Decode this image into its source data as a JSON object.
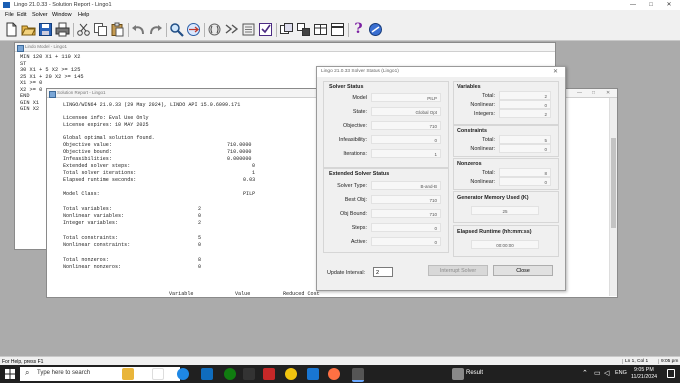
{
  "app": {
    "title": "Lingo 21.0.33 - Solution Report - Lingo1",
    "min": "—",
    "max": "□",
    "close": "✕"
  },
  "menu": [
    "File",
    "Edit",
    "Solver",
    "Window",
    "Help"
  ],
  "toolbar_icons": [
    "new-file-icon",
    "open-file-icon",
    "save-icon",
    "print-icon",
    "cut-icon",
    "copy-icon",
    "paste-icon",
    "undo-icon",
    "redo-icon",
    "find-icon",
    "goto-icon",
    "match-parenthesis-icon",
    "solve-icon",
    "solution-icon",
    "formulation-icon",
    "options-icon",
    "send-to-back-icon",
    "close-all-icon",
    "tile-icon",
    "help-icon",
    "context-help-icon"
  ],
  "model_window": {
    "title": "Lindo Model - Lingo1",
    "text": "MIN 120 X1 + 110 X2\nST\n30 X1 + 5 X2 >= 125\n25 X1 + 20 X2 >= 145\nX1 >= 0\nX2 >= 0\nEND\nGIN X1\nGIN X2"
  },
  "report_window": {
    "title": "Solution Report - Lingo1",
    "header": "LINGO/WIN64 21.0.33 (29 May 2024), LINDO API 15.0.6099.171",
    "license1": "Licensee info: Eval Use Only",
    "license2": "License expires: 10 MAY 2025",
    "found": "Global optimal solution found.",
    "rows": [
      [
        "Objective value:",
        "710.0000"
      ],
      [
        "Objective bound:",
        "710.0000"
      ],
      [
        "Infeasibilities:",
        "0.000000"
      ],
      [
        "Extended solver steps:",
        "0"
      ],
      [
        "Total solver iterations:",
        "1"
      ],
      [
        "Elapsed runtime seconds:",
        "0.03"
      ]
    ],
    "model_class": [
      "Model Class:",
      "PILP"
    ],
    "counts1": [
      [
        "Total variables:",
        "2"
      ],
      [
        "Nonlinear variables:",
        "0"
      ],
      [
        "Integer variables:",
        "2"
      ]
    ],
    "counts2": [
      [
        "Total constraints:",
        "5"
      ],
      [
        "Nonlinear constraints:",
        "0"
      ]
    ],
    "counts3": [
      [
        "Total nonzeros:",
        "8"
      ],
      [
        "Nonlinear nonzeros:",
        "0"
      ]
    ],
    "table_header": [
      "Variable",
      "Value",
      "Reduced Cost"
    ]
  },
  "dialog": {
    "title": "Lingo 21.0.33 Solver Status (Lingo1)",
    "solver_status": {
      "title": "Solver Status",
      "rows": [
        [
          "Model",
          "PILP"
        ],
        [
          "State:",
          "Global Opt"
        ],
        [
          "Objective:",
          "710"
        ],
        [
          "Infeasibility:",
          "0"
        ],
        [
          "Iterations:",
          "1"
        ]
      ]
    },
    "extended": {
      "title": "Extended Solver Status",
      "rows": [
        [
          "Solver Type:",
          "B-and-B"
        ],
        [
          "Best Obj:",
          "710"
        ],
        [
          "Obj Bound:",
          "710"
        ],
        [
          "Steps:",
          "0"
        ],
        [
          "Active:",
          "0"
        ]
      ]
    },
    "variables": {
      "title": "Variables",
      "rows": [
        [
          "Total:",
          "2"
        ],
        [
          "Nonlinear:",
          "0"
        ],
        [
          "Integers:",
          "2"
        ]
      ]
    },
    "constraints": {
      "title": "Constraints",
      "rows": [
        [
          "Total:",
          "5"
        ],
        [
          "Nonlinear:",
          "0"
        ]
      ]
    },
    "nonzeros": {
      "title": "Nonzeros",
      "rows": [
        [
          "Total:",
          "8"
        ],
        [
          "Nonlinear:",
          "0"
        ]
      ]
    },
    "memory": {
      "title": "Generator Memory Used (K)",
      "value": "25"
    },
    "runtime": {
      "title": "Elapsed Runtime (hh:mm:ss)",
      "value": "00:00:00"
    },
    "update_label": "Update Interval:",
    "update_value": "2",
    "interrupt": "Interrupt Solver",
    "close": "Close"
  },
  "statusbar": {
    "help": "For Help, press F1",
    "position": "Ln 1, Col 1",
    "time": "9:05 pm"
  },
  "taskbar": {
    "search": "Type here to search",
    "result": "Result",
    "lang": "ENG",
    "clock_time": "9:05 PM",
    "clock_date": "11/21/2024"
  }
}
